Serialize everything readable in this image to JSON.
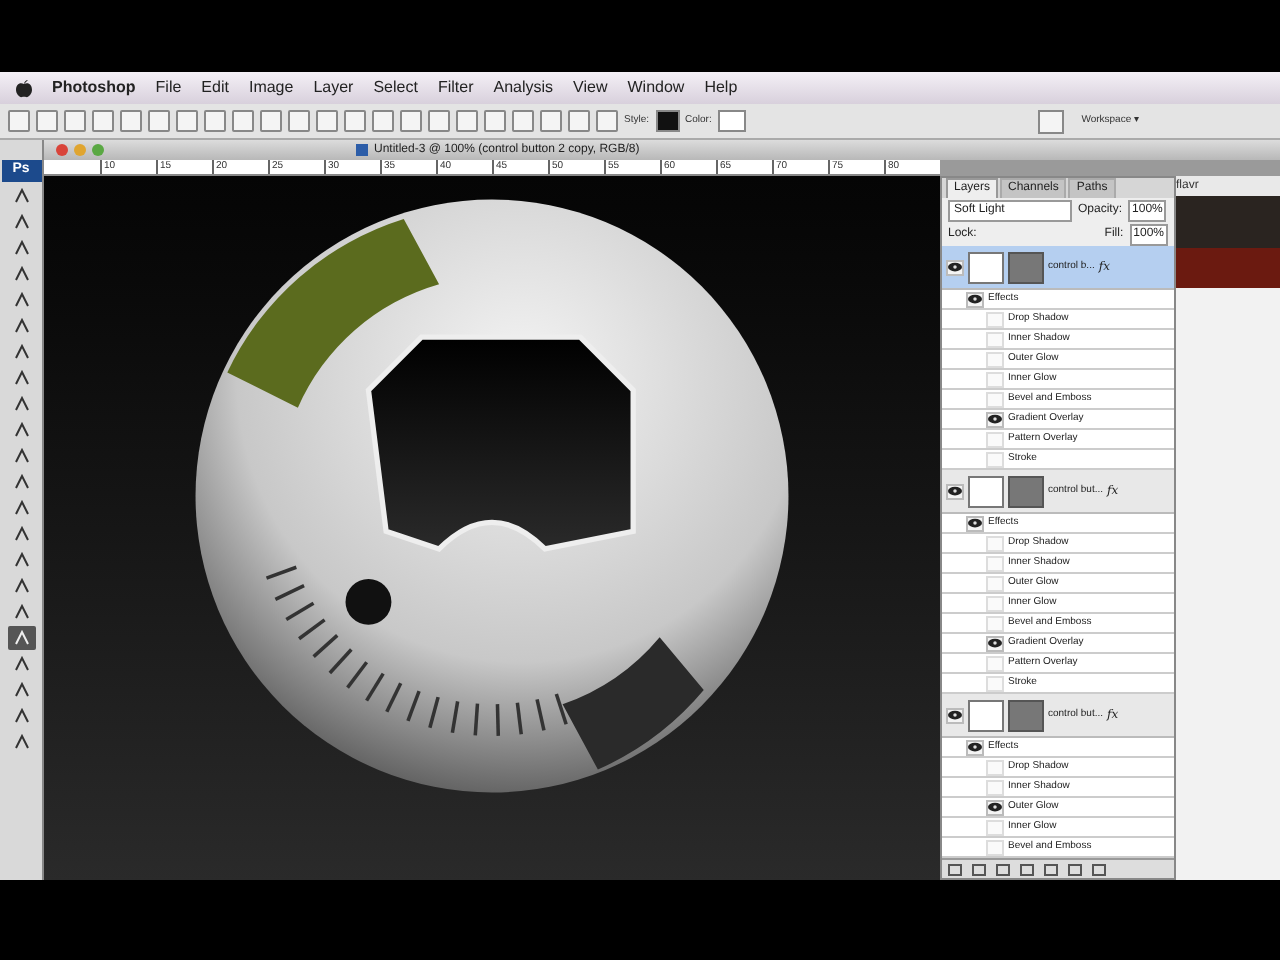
{
  "menu_bar": {
    "app": "Photoshop",
    "items": [
      "File",
      "Edit",
      "Image",
      "Layer",
      "Select",
      "Filter",
      "Analysis",
      "View",
      "Window",
      "Help"
    ]
  },
  "options_bar": {
    "style_label": "Style:",
    "color_label": "Color:",
    "workspace": "Workspace ▾"
  },
  "document": {
    "title": "Untitled-3 @ 100% (control button 2 copy, RGB/8)",
    "ruler_labels": [
      "10",
      "15",
      "20",
      "25",
      "30",
      "35",
      "40",
      "45",
      "50",
      "55",
      "60",
      "65",
      "70",
      "75",
      "80"
    ]
  },
  "tools_panel": {
    "logo": "Ps",
    "tools": [
      {
        "selected": false
      },
      {
        "selected": false
      },
      {
        "selected": false
      },
      {
        "selected": false
      },
      {
        "selected": false
      },
      {
        "selected": false
      },
      {
        "selected": false
      },
      {
        "selected": false
      },
      {
        "selected": false
      },
      {
        "selected": false
      },
      {
        "selected": false
      },
      {
        "selected": false
      },
      {
        "selected": false
      },
      {
        "selected": false
      },
      {
        "selected": false
      },
      {
        "selected": false
      },
      {
        "selected": false
      },
      {
        "selected": true
      },
      {
        "selected": false
      },
      {
        "selected": false
      },
      {
        "selected": false
      },
      {
        "selected": false
      }
    ]
  },
  "layers_panel": {
    "tabs": [
      {
        "label": "Layers",
        "selected": true
      },
      {
        "label": "Channels",
        "selected": false
      },
      {
        "label": "Paths",
        "selected": false
      }
    ],
    "blend_mode": "Soft Light",
    "opacity_label": "Opacity:",
    "opacity": "100%",
    "lock_label": "Lock:",
    "fill_label": "Fill:",
    "fill": "100%",
    "layers": [
      {
        "name": "control b...",
        "fx_label": "fx",
        "selected": true,
        "effects_label": "Effects",
        "effects": [
          {
            "name": "Drop Shadow",
            "visible": false
          },
          {
            "name": "Inner Shadow",
            "visible": false
          },
          {
            "name": "Outer Glow",
            "visible": false
          },
          {
            "name": "Inner Glow",
            "visible": false
          },
          {
            "name": "Bevel and Emboss",
            "visible": false
          },
          {
            "name": "Gradient Overlay",
            "visible": true
          },
          {
            "name": "Pattern Overlay",
            "visible": false
          },
          {
            "name": "Stroke",
            "visible": false
          }
        ]
      },
      {
        "name": "control but...",
        "fx_label": "fx",
        "selected": false,
        "effects_label": "Effects",
        "effects": [
          {
            "name": "Drop Shadow",
            "visible": false
          },
          {
            "name": "Inner Shadow",
            "visible": false
          },
          {
            "name": "Outer Glow",
            "visible": false
          },
          {
            "name": "Inner Glow",
            "visible": false
          },
          {
            "name": "Bevel and Emboss",
            "visible": false
          },
          {
            "name": "Gradient Overlay",
            "visible": true
          },
          {
            "name": "Pattern Overlay",
            "visible": false
          },
          {
            "name": "Stroke",
            "visible": false
          }
        ]
      },
      {
        "name": "control but...",
        "fx_label": "fx",
        "selected": false,
        "effects_label": "Effects",
        "effects": [
          {
            "name": "Drop Shadow",
            "visible": false
          },
          {
            "name": "Inner Shadow",
            "visible": false
          },
          {
            "name": "Outer Glow",
            "visible": true
          },
          {
            "name": "Inner Glow",
            "visible": false
          },
          {
            "name": "Bevel and Emboss",
            "visible": false
          }
        ]
      }
    ]
  },
  "background_page": {
    "text": "flavr"
  }
}
